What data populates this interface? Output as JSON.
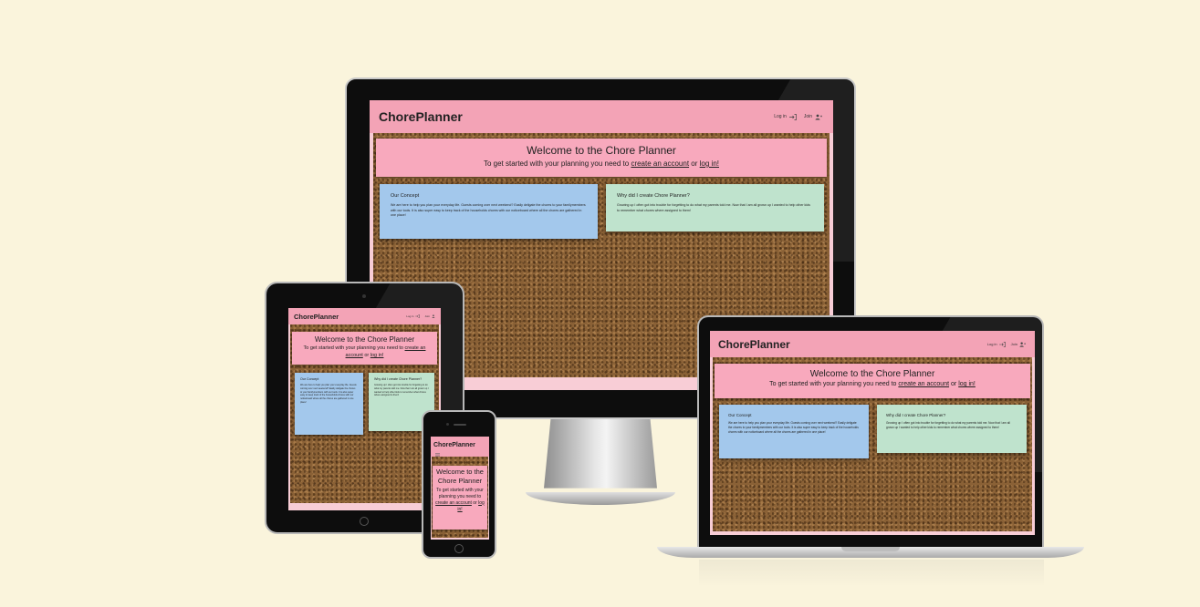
{
  "site": {
    "brand": "ChorePlanner",
    "nav": {
      "login": "Log in",
      "join": "Join"
    },
    "welcome": {
      "title": "Welcome to the Chore Planner",
      "subtitle_start": "To get started with your planning you need to",
      "create_account_link": "create an account",
      "or": "or",
      "login_link": "log in!"
    },
    "concept": {
      "title": "Our Concept",
      "text": "We are here to help you plan your everyday life. Guests coming over next weekend? Easily deligate the chores to your familymembers with our tools. It is also super easy to keep track of the households chores with our noticeboard where all the chores are gathered in one place!"
    },
    "why": {
      "title": "Why did I create Chore Planner?",
      "text": "Growing up I often got into trouble for forgetting to do what my parents told me. Now that I am all grown up I wanted to help other kids to remember what chores where assigned to them!"
    }
  },
  "colors": {
    "background": "#faf4dc",
    "nav": "#f3a3b6",
    "welcome_box": "#f8a9bd",
    "concept_card": "#a3c8ec",
    "why_card": "#bfe3cd",
    "cork": "#8a6136"
  },
  "icons": [
    "login-icon",
    "join-user-icon",
    "hamburger-menu-icon"
  ]
}
